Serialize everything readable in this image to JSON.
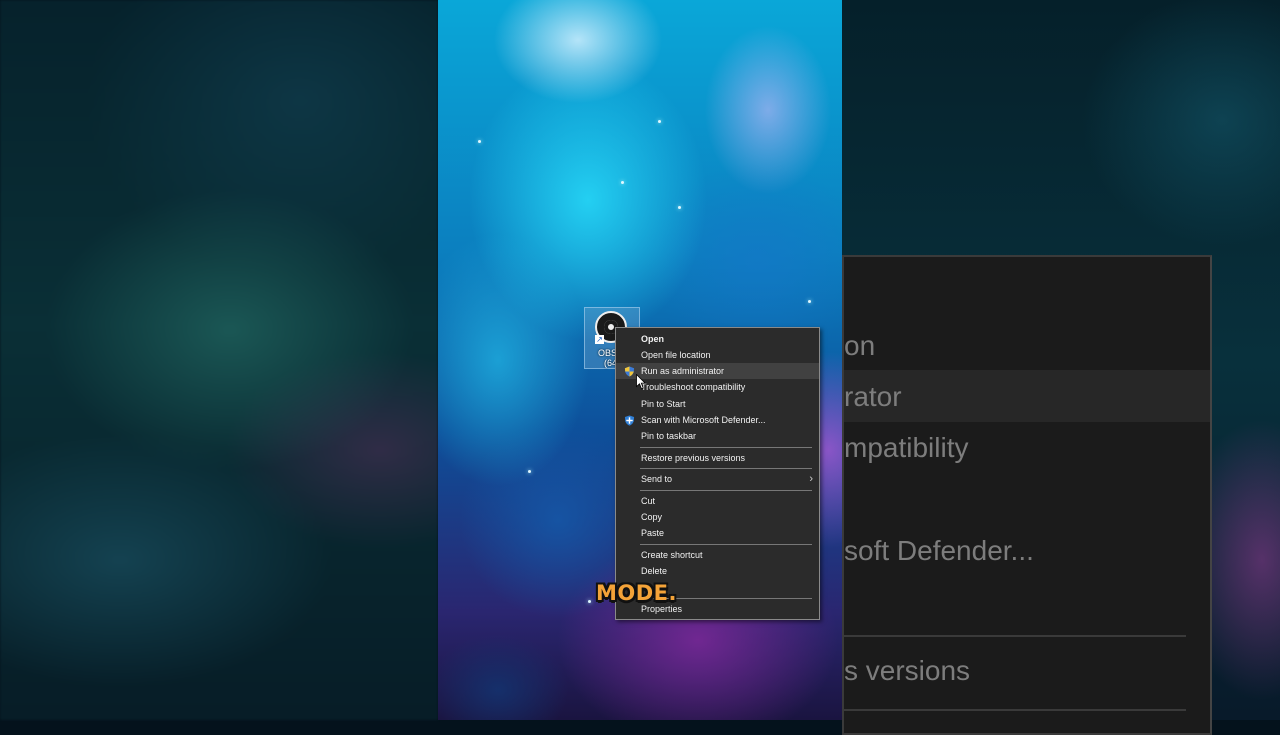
{
  "desktop": {
    "icon_name": "obs-studio-icon",
    "icon_label_line1": "OBS St",
    "icon_label_line2": "(64b"
  },
  "context_menu": {
    "items": [
      {
        "label": "Open"
      },
      {
        "label": "Open file location"
      },
      {
        "label": "Run as administrator"
      },
      {
        "label": "Troubleshoot compatibility"
      },
      {
        "label": "Pin to Start"
      },
      {
        "label": "Scan with Microsoft Defender..."
      },
      {
        "label": "Pin to taskbar"
      },
      {
        "label": "Restore previous versions"
      },
      {
        "label": "Send to"
      },
      {
        "label": "Cut"
      },
      {
        "label": "Copy"
      },
      {
        "label": "Paste"
      },
      {
        "label": "Create shortcut"
      },
      {
        "label": "Delete"
      },
      {
        "label": "Properties"
      }
    ],
    "icons": {
      "run_as_admin": "uac-shield-icon",
      "defender": "defender-shield-icon",
      "send_to": "chevron-right-icon"
    }
  },
  "zoomed_menu": {
    "line1": "on",
    "line2": "rator",
    "line3": "mpatibility",
    "line4": "soft Defender...",
    "line5": "s versions"
  },
  "caption": {
    "text": "MODE."
  },
  "colors": {
    "menu_bg": "#2b2b2b",
    "menu_hover": "#414141",
    "caption": "#f4a338"
  }
}
